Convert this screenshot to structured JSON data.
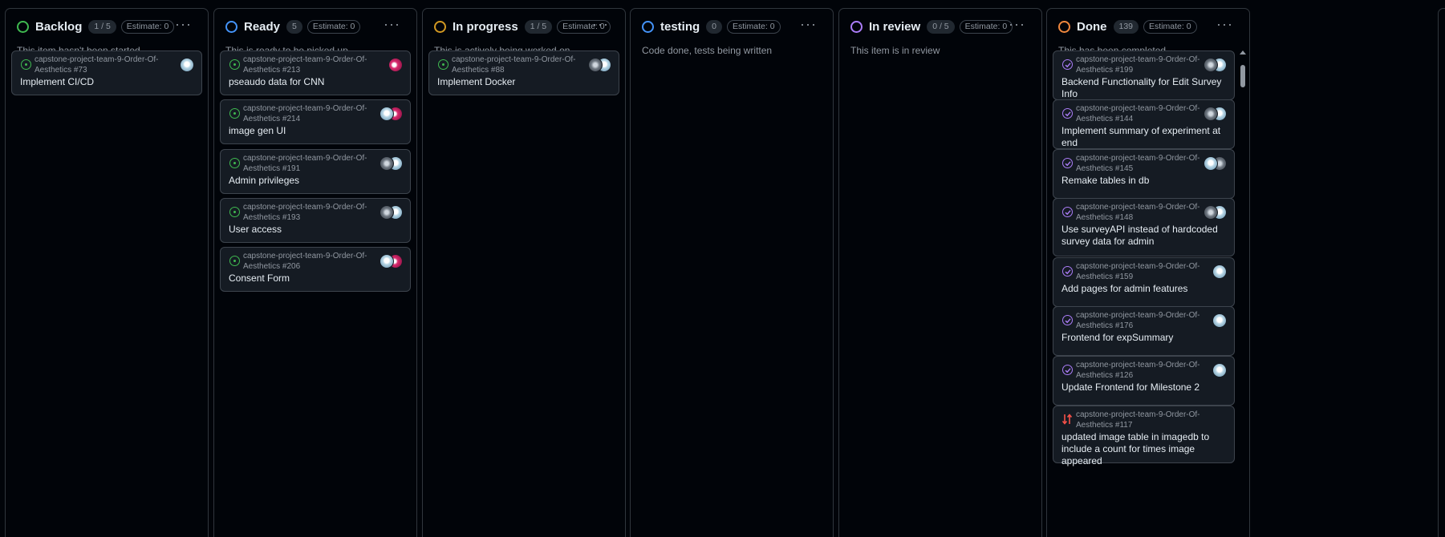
{
  "columns": [
    {
      "title": "Backlog",
      "count": "1 / 5",
      "estimate": "Estimate: 0",
      "description": "This item hasn't been started",
      "color": "#3fb950",
      "cards": [
        {
          "ref": "capstone-project-team-9-Order-Of-Aesthetics #73",
          "title": "Implement CI/CD",
          "state": "open",
          "avatars": [
            "light"
          ]
        }
      ]
    },
    {
      "title": "Ready",
      "count": "5",
      "estimate": "Estimate: 0",
      "description": "This is ready to be picked up",
      "color": "#4493f8",
      "cards": [
        {
          "ref": "capstone-project-team-9-Order-Of-Aesthetics #213",
          "title": "pseaudo data for CNN",
          "state": "open",
          "avatars": [
            "pink"
          ]
        },
        {
          "ref": "capstone-project-team-9-Order-Of-Aesthetics #214",
          "title": "image gen UI",
          "state": "open",
          "avatars": [
            "pink",
            "light"
          ]
        },
        {
          "ref": "capstone-project-team-9-Order-Of-Aesthetics #191",
          "title": "Admin privileges",
          "state": "open",
          "avatars": [
            "light",
            "gray"
          ]
        },
        {
          "ref": "capstone-project-team-9-Order-Of-Aesthetics #193",
          "title": "User access",
          "state": "open",
          "avatars": [
            "light",
            "gray"
          ]
        },
        {
          "ref": "capstone-project-team-9-Order-Of-Aesthetics #206",
          "title": "Consent Form",
          "state": "open",
          "avatars": [
            "pink",
            "light"
          ]
        }
      ]
    },
    {
      "title": "In progress",
      "count": "1 / 5",
      "estimate": "Estimate: 0",
      "description": "This is actively being worked on",
      "color": "#d29922",
      "cards": [
        {
          "ref": "capstone-project-team-9-Order-Of-Aesthetics #88",
          "title": "Implement Docker",
          "state": "open",
          "avatars": [
            "light",
            "gray"
          ]
        }
      ]
    },
    {
      "title": "testing",
      "count": "0",
      "estimate": "Estimate: 0",
      "description": "Code done, tests being written",
      "color": "#4493f8",
      "cards": []
    },
    {
      "title": "In review",
      "count": "0 / 5",
      "estimate": "Estimate: 0",
      "description": "This item is in review",
      "color": "#ab7df8",
      "cards": []
    },
    {
      "title": "Done",
      "count": "139",
      "estimate": "Estimate: 0",
      "description": "This has been completed",
      "color": "#f0883e",
      "cards": [
        {
          "ref": "capstone-project-team-9-Order-Of-Aesthetics #199",
          "title": "Backend Functionality for Edit Survey Info",
          "state": "closed",
          "avatars": [
            "light",
            "gray"
          ]
        },
        {
          "ref": "capstone-project-team-9-Order-Of-Aesthetics #144",
          "title": "Implement summary of experiment at end",
          "state": "closed",
          "avatars": [
            "light",
            "gray"
          ]
        },
        {
          "ref": "capstone-project-team-9-Order-Of-Aesthetics #145",
          "title": "Remake tables in db",
          "state": "closed",
          "avatars": [
            "gray",
            "light"
          ]
        },
        {
          "ref": "capstone-project-team-9-Order-Of-Aesthetics #148",
          "title": "Use surveyAPI instead of hardcoded survey data for admin",
          "state": "closed",
          "avatars": [
            "light",
            "gray"
          ]
        },
        {
          "ref": "capstone-project-team-9-Order-Of-Aesthetics #159",
          "title": "Add pages for admin features",
          "state": "closed",
          "avatars": [
            "light"
          ]
        },
        {
          "ref": "capstone-project-team-9-Order-Of-Aesthetics #176",
          "title": "Frontend for expSummary",
          "state": "closed",
          "avatars": [
            "light"
          ]
        },
        {
          "ref": "capstone-project-team-9-Order-Of-Aesthetics #126",
          "title": "Update Frontend for Milestone 2",
          "state": "closed",
          "avatars": [
            "light"
          ]
        },
        {
          "ref": "capstone-project-team-9-Order-Of-Aesthetics #117",
          "title": "updated image table in imagedb to include a count for times image appeared",
          "state": "pr",
          "avatars": []
        }
      ]
    }
  ],
  "menu_glyph": "···",
  "colors": {
    "open": "#3fb950",
    "closed": "#ab7df8",
    "pr": "#f85149"
  }
}
